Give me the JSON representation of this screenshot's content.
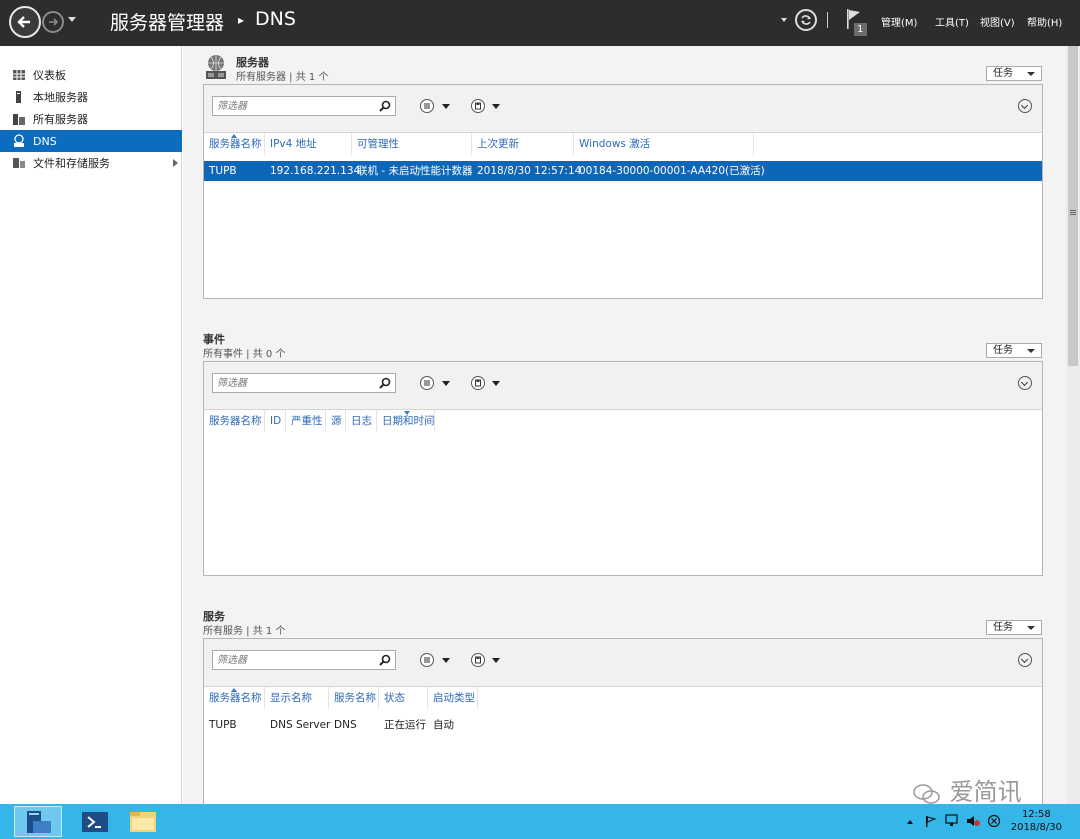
{
  "window": {
    "app_title": "服务器管理器",
    "separator": "▸",
    "page": "DNS",
    "flag_badge": "1",
    "menus": [
      {
        "label": "管理(M)"
      },
      {
        "label": "工具(T)"
      },
      {
        "label": "视图(V)"
      },
      {
        "label": "帮助(H)"
      }
    ]
  },
  "sidebar": {
    "items": [
      {
        "label": "仪表板",
        "icon": "dashboard-icon"
      },
      {
        "label": "本地服务器",
        "icon": "local-server-icon"
      },
      {
        "label": "所有服务器",
        "icon": "all-servers-icon"
      },
      {
        "label": "DNS",
        "icon": "dns-icon",
        "active": true
      },
      {
        "label": "文件和存储服务",
        "icon": "file-storage-icon",
        "has_children": true
      }
    ]
  },
  "servers": {
    "title": "服务器",
    "subtitle": "所有服务器 | 共 1 个",
    "tasks_label": "任务",
    "filter_placeholder": "筛选器",
    "columns": [
      "服务器名称",
      "IPv4 地址",
      "可管理性",
      "上次更新",
      "Windows 激活"
    ],
    "rows": [
      [
        "TUPB",
        "192.168.221.134",
        "联机 - 未启动性能计数器",
        "2018/8/30 12:57:14",
        "00184-30000-00001-AA420(已激活)"
      ]
    ]
  },
  "events": {
    "title": "事件",
    "subtitle": "所有事件 | 共 0 个",
    "tasks_label": "任务",
    "filter_placeholder": "筛选器",
    "columns": [
      "服务器名称",
      "ID",
      "严重性",
      "源",
      "日志",
      "日期和时间"
    ]
  },
  "services": {
    "title": "服务",
    "subtitle": "所有服务 | 共 1 个",
    "tasks_label": "任务",
    "filter_placeholder": "筛选器",
    "columns": [
      "服务器名称",
      "显示名称",
      "服务名称",
      "状态",
      "启动类型"
    ],
    "rows": [
      [
        "TUPB",
        "DNS Server",
        "DNS",
        "正在运行",
        "自动"
      ]
    ]
  },
  "taskbar": {
    "time": "12:58",
    "date": "2018/8/30",
    "watermark": "爱简讯"
  },
  "colors": {
    "titlebar": "#2d2d30",
    "accent": "#0c6cc0",
    "taskbar": "#35b6e8",
    "link": "#2e6ab5"
  }
}
